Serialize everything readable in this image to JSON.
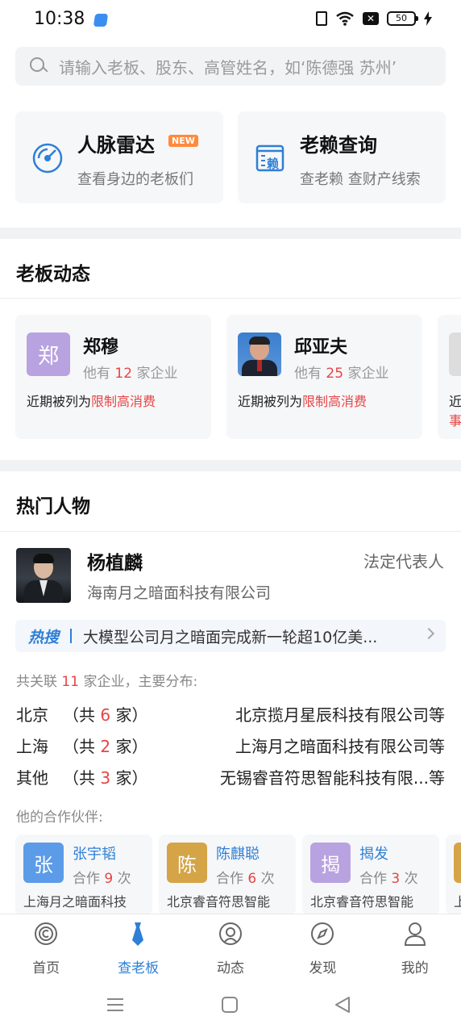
{
  "status": {
    "time": "10:38",
    "battery": "50"
  },
  "search": {
    "placeholder": "请输入老板、股东、高管姓名，如‘陈德强 苏州’"
  },
  "features": [
    {
      "title": "人脉雷达",
      "badge": "NEW",
      "subtitle": "查看身边的老板们",
      "icon": "radar-icon"
    },
    {
      "title": "老赖查询",
      "subtitle": "查老赖 查财产线索",
      "icon": "document-lai-icon",
      "icon_text": "赖"
    }
  ],
  "boss_section": {
    "title": "老板动态",
    "cards": [
      {
        "avatar_text": "郑",
        "avatar_color": "#b9a2e0",
        "name": "郑穆",
        "count_prefix": "他有",
        "count": "12",
        "count_suffix": "家企业",
        "note_prefix": "近期被列为",
        "note_highlight": "限制高消费"
      },
      {
        "avatar_photo": "man-in-suit-photo",
        "name": "邱亚夫",
        "count_prefix": "他有",
        "count": "25",
        "count_suffix": "家企业",
        "note_prefix": "近期被列为",
        "note_highlight": "限制高消费"
      },
      {
        "avatar_photo": "partial-photo",
        "note_prefix": "近",
        "note_highlight": "事"
      }
    ]
  },
  "hot_section": {
    "title": "热门人物",
    "person": {
      "name": "杨植麟",
      "role": "法定代表人",
      "company": "海南月之暗面科技有限公司"
    },
    "hot_search": {
      "tag": "热搜",
      "text": "大模型公司月之暗面完成新一轮超10亿美..."
    },
    "related": {
      "prefix": "共关联",
      "count": "11",
      "suffix": "家企业，主要分布:"
    },
    "regions": [
      {
        "name": "北京",
        "count_prefix": "（共",
        "count": "6",
        "count_suffix": "家）",
        "company": "北京揽月星辰科技有限公司等"
      },
      {
        "name": "上海",
        "count_prefix": "（共",
        "count": "2",
        "count_suffix": "家）",
        "company": "上海月之暗面科技有限公司等"
      },
      {
        "name": "其他",
        "count_prefix": "（共",
        "count": "3",
        "count_suffix": "家）",
        "company": "无锡睿音符思智能科技有限...等"
      }
    ],
    "partner_label": "他的合作伙伴:",
    "partners": [
      {
        "avatar_text": "张",
        "avatar_color": "#5b9be8",
        "name": "张宇韬",
        "coop_prefix": "合作",
        "coop": "9",
        "coop_suffix": "次",
        "company": "上海月之暗面科技"
      },
      {
        "avatar_text": "陈",
        "avatar_color": "#d4a447",
        "name": "陈麒聪",
        "coop_prefix": "合作",
        "coop": "6",
        "coop_suffix": "次",
        "company": "北京睿音符思智能"
      },
      {
        "avatar_text": "揭",
        "avatar_color": "#b9a2e0",
        "name": "揭发",
        "coop_prefix": "合作",
        "coop": "3",
        "coop_suffix": "次",
        "company": "北京睿音符思智能"
      },
      {
        "avatar_text": "",
        "avatar_color": "#d4a447",
        "name": "",
        "company": "上"
      }
    ]
  },
  "bottom_nav": [
    {
      "label": "首页",
      "icon": "home-icon"
    },
    {
      "label": "查老板",
      "icon": "tie-icon",
      "active": true
    },
    {
      "label": "动态",
      "icon": "dynamic-icon"
    },
    {
      "label": "发现",
      "icon": "compass-icon"
    },
    {
      "label": "我的",
      "icon": "profile-icon"
    }
  ],
  "colors": {
    "accent": "#2e7fd6",
    "highlight": "#e64545",
    "badge": "#ff8a3d"
  }
}
